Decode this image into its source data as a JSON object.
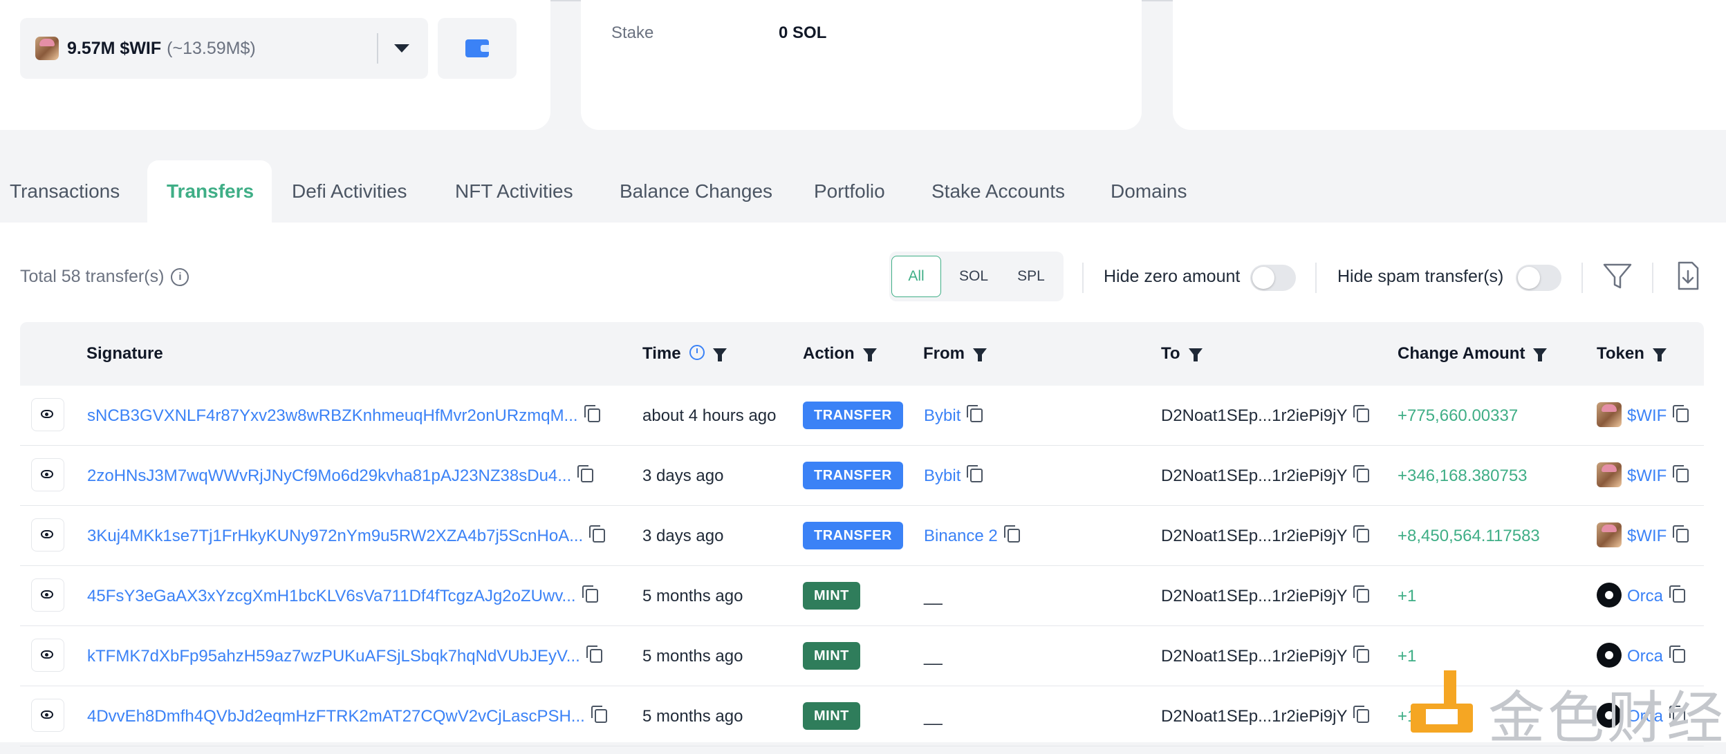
{
  "header": {
    "token_selector": {
      "amount": "9.57M $WIF",
      "usd": "(~13.59M$)"
    },
    "stake": {
      "label": "Stake",
      "value": "0 SOL"
    }
  },
  "tabs": [
    {
      "label": "Transactions",
      "active": false
    },
    {
      "label": "Transfers",
      "active": true
    },
    {
      "label": "Defi Activities",
      "active": false
    },
    {
      "label": "NFT Activities",
      "active": false
    },
    {
      "label": "Balance Changes",
      "active": false
    },
    {
      "label": "Portfolio",
      "active": false
    },
    {
      "label": "Stake Accounts",
      "active": false
    },
    {
      "label": "Domains",
      "active": false
    }
  ],
  "toolbar": {
    "total": "Total 58 transfer(s)",
    "segments": [
      "All",
      "SOL",
      "SPL"
    ],
    "active_segment": "All",
    "hide_zero_label": "Hide zero amount",
    "hide_zero_on": false,
    "hide_spam_label": "Hide spam transfer(s)",
    "hide_spam_on": false
  },
  "table": {
    "columns": [
      "Signature",
      "Time",
      "Action",
      "From",
      "To",
      "Change Amount",
      "Token"
    ],
    "rows": [
      {
        "signature": "sNCB3GVXNLF4r87Yxv23w8wRBZKnhmeuqHfMvr2onURzmqM...",
        "time": "about 4 hours ago",
        "action": "TRANSFER",
        "from": "Bybit",
        "to": "D2Noat1SEp...1r2iePi9jY",
        "amount": "+775,660.00337",
        "token": "$WIF"
      },
      {
        "signature": "2zoHNsJ3M7wqWWvRjJNyCf9Mo6d29kvha81pAJ23NZ38sDu4...",
        "time": "3 days ago",
        "action": "TRANSFER",
        "from": "Bybit",
        "to": "D2Noat1SEp...1r2iePi9jY",
        "amount": "+346,168.380753",
        "token": "$WIF"
      },
      {
        "signature": "3Kuj4MKk1se7Tj1FrHkyKUNy972nYm9u5RW2XZA4b7j5ScnHoA...",
        "time": "3 days ago",
        "action": "TRANSFER",
        "from": "Binance 2",
        "to": "D2Noat1SEp...1r2iePi9jY",
        "amount": "+8,450,564.117583",
        "token": "$WIF"
      },
      {
        "signature": "45FsY3eGaAX3xYzcgXmH1bcKLV6sVa711Df4fTcgzAJg2oZUwv...",
        "time": "5 months ago",
        "action": "MINT",
        "from": "__",
        "to": "D2Noat1SEp...1r2iePi9jY",
        "amount": "+1",
        "token": "Orca"
      },
      {
        "signature": "kTFMK7dXbFp95ahzH59az7wzPUKuAFSjLSbqk7hqNdVUbJEyV...",
        "time": "5 months ago",
        "action": "MINT",
        "from": "__",
        "to": "D2Noat1SEp...1r2iePi9jY",
        "amount": "+1",
        "token": "Orca"
      },
      {
        "signature": "4DvvEh8Dmfh4QVbJd2eqmHzFTRK2mAT27CQwV2vCjLascPSH...",
        "time": "5 months ago",
        "action": "MINT",
        "from": "__",
        "to": "D2Noat1SEp...1r2iePi9jY",
        "amount": "+1",
        "token": "Orca"
      }
    ]
  },
  "watermark": {
    "text": "金色财经"
  },
  "colors": {
    "accent": "#3fae86",
    "link": "#3b82f6",
    "transfer_badge": "#3b82f6",
    "mint_badge": "#2f7d5b",
    "watermark_logo": "#f5a623"
  },
  "icons": [
    "wallet-icon",
    "info-icon",
    "filter-icon",
    "download-icon",
    "clock-icon",
    "eye-icon",
    "copy-icon"
  ]
}
